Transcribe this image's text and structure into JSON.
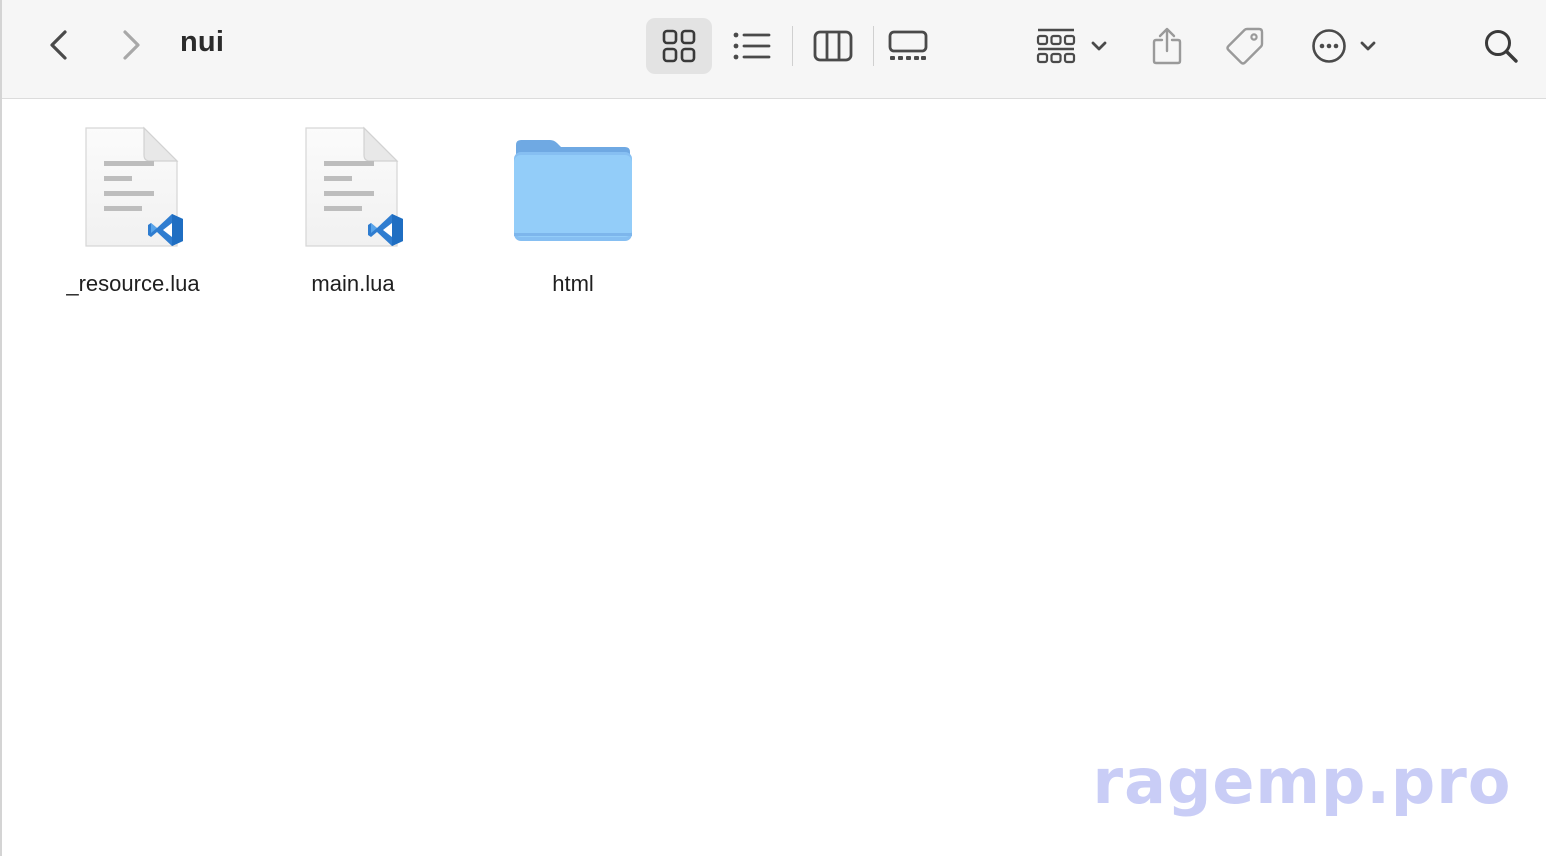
{
  "window": {
    "title": "nui"
  },
  "toolbar": {
    "back_icon": "chevron-left-icon",
    "forward_icon": "chevron-right-icon",
    "views": [
      {
        "name": "icon-view",
        "icon": "grid-icon",
        "selected": true
      },
      {
        "name": "list-view",
        "icon": "list-icon",
        "selected": false
      },
      {
        "name": "column-view",
        "icon": "columns-icon",
        "selected": false
      },
      {
        "name": "gallery-view",
        "icon": "gallery-icon",
        "selected": false
      }
    ],
    "group_icon": "group-grid-icon",
    "share_icon": "share-icon",
    "tag_icon": "tag-icon",
    "more_icon": "ellipsis-circle-icon",
    "search_icon": "search-icon"
  },
  "files": [
    {
      "name": "_resource.lua",
      "type": "file",
      "icon": "vscode-document-icon"
    },
    {
      "name": "main.lua",
      "type": "file",
      "icon": "vscode-document-icon"
    },
    {
      "name": "html",
      "type": "folder",
      "icon": "folder-icon"
    }
  ],
  "watermark": {
    "text": "ragemp.pro"
  },
  "colors": {
    "toolbar_bg": "#f6f6f6",
    "selected_view_bg": "#e3e3e3",
    "folder_blue": "#93cdf9",
    "folder_tab": "#6fa9e3",
    "vscode_blue": "#2f7dd0",
    "watermark": "#c9cdf6"
  }
}
